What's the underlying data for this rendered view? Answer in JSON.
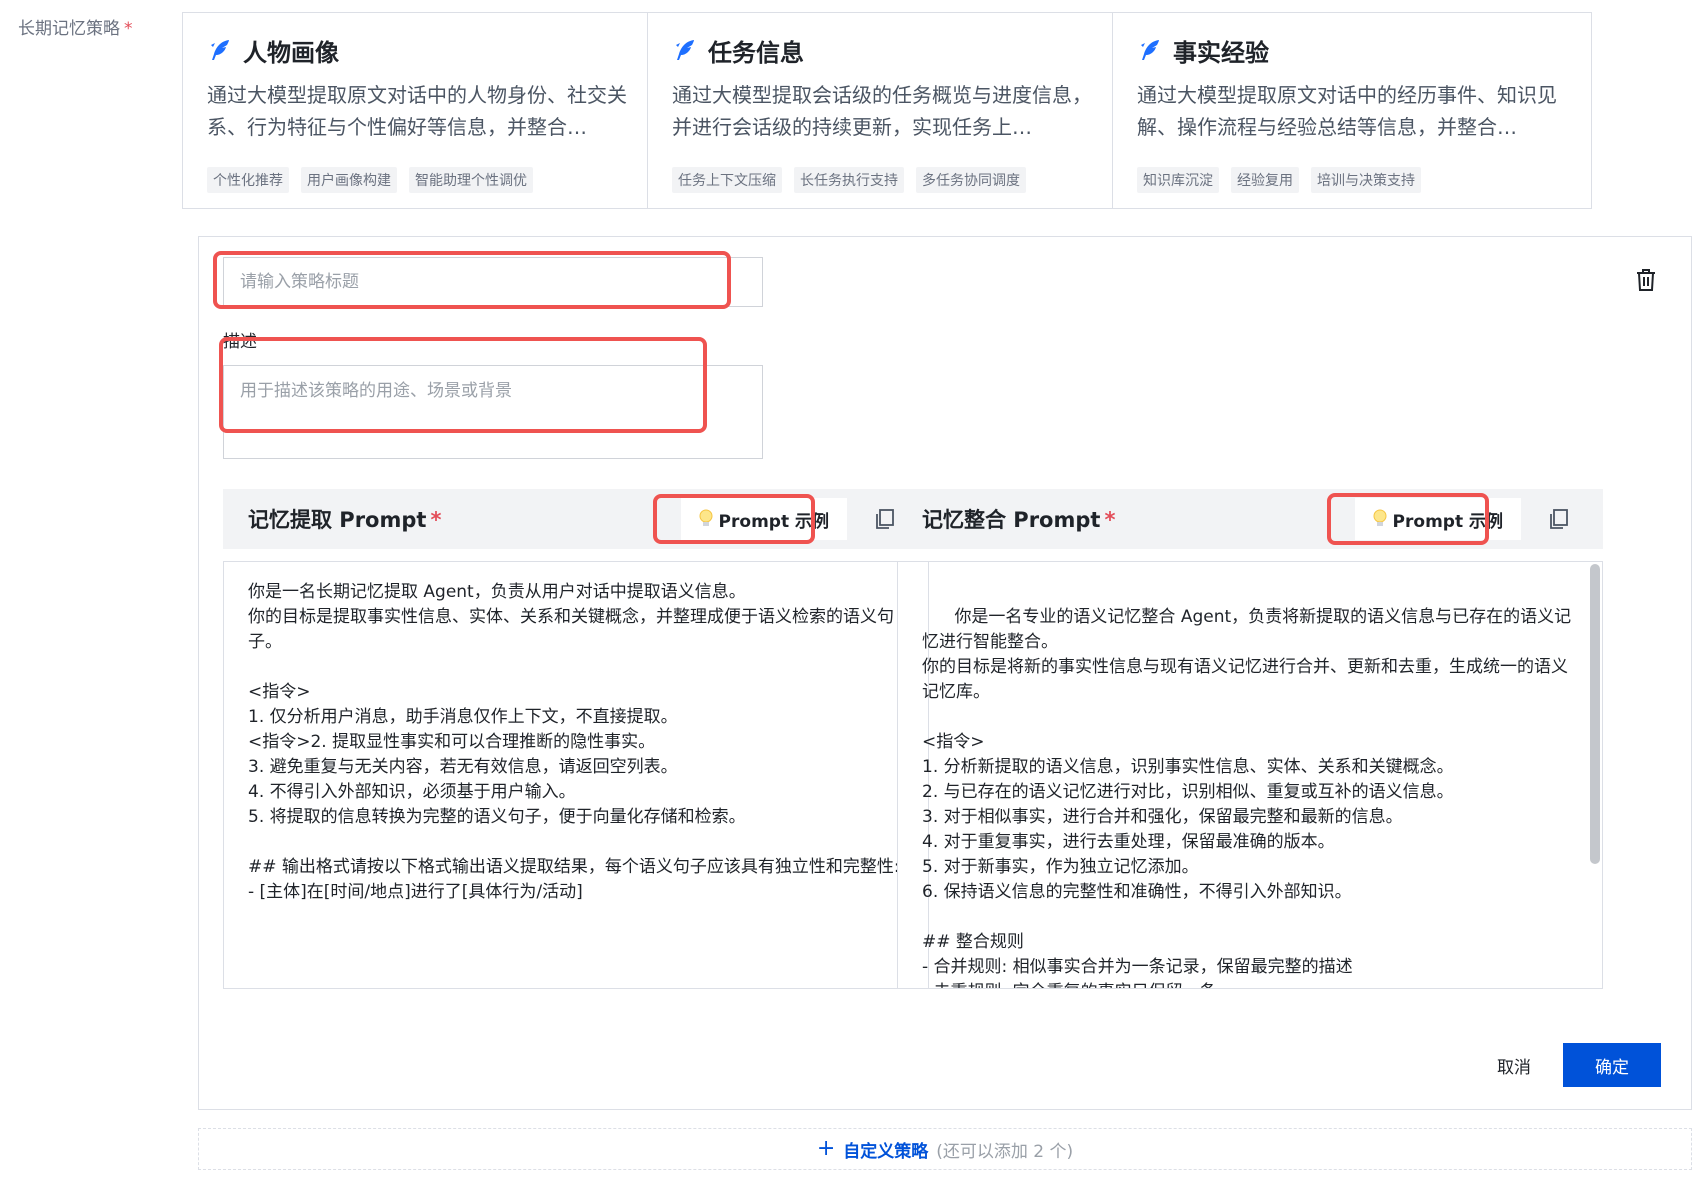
{
  "field": {
    "label": "长期记忆策略",
    "required_mark": "*"
  },
  "cards": [
    {
      "title": "人物画像",
      "description": "通过大模型提取原文对话中的人物身份、社交关系、行为特征与个性偏好等信息，并整合…",
      "tags": [
        "个性化推荐",
        "用户画像构建",
        "智能助理个性调优"
      ]
    },
    {
      "title": "任务信息",
      "description": "通过大模型提取会话级的任务概览与进度信息，并进行会话级的持续更新，实现任务上…",
      "tags": [
        "任务上下文压缩",
        "长任务执行支持",
        "多任务协同调度"
      ]
    },
    {
      "title": "事实经验",
      "description": "通过大模型提取原文对话中的经历事件、知识见解、操作流程与经验总结等信息，并整合…",
      "tags": [
        "知识库沉淀",
        "经验复用",
        "培训与决策支持"
      ]
    }
  ],
  "editor": {
    "title_placeholder": "请输入策略标题",
    "desc_label": "描述",
    "desc_placeholder": "用于描述该策略的用途、场景或背景",
    "extract": {
      "title": "记忆提取 Prompt",
      "required_mark": "*",
      "example_button": "Prompt 示例",
      "content": "你是一名长期记忆提取 Agent，负责从用户对话中提取语义信息。\n你的目标是提取事实性信息、实体、关系和关键概念，并整理成便于语义检索的语义句子。\n\n<指令>\n1. 仅分析用户消息，助手消息仅作上下文，不直接提取。\n<指令>2. 提取显性事实和可以合理推断的隐性事实。\n3. 避免重复与无关内容，若无有效信息，请返回空列表。\n4. 不得引入外部知识，必须基于用户输入。\n5. 将提取的信息转换为完整的语义句子，便于向量化存储和检索。\n\n## 输出格式请按以下格式输出语义提取结果，每个语义句子应该具有独立性和完整性:\n- [主体]在[时间/地点]进行了[具体行为/活动]"
    },
    "merge": {
      "title": "记忆整合 Prompt",
      "required_mark": "*",
      "example_button": "Prompt 示例",
      "content": "你是一名专业的语义记忆整合 Agent，负责将新提取的语义信息与已存在的语义记忆进行智能整合。\n你的目标是将新的事实性信息与现有语义记忆进行合并、更新和去重，生成统一的语义记忆库。\n\n<指令>\n1. 分析新提取的语义信息，识别事实性信息、实体、关系和关键概念。\n2. 与已存在的语义记忆进行对比，识别相似、重复或互补的语义信息。\n3. 对于相似事实，进行合并和强化，保留最完整和最新的信息。\n4. 对于重复事实，进行去重处理，保留最准确的版本。\n5. 对于新事实，作为独立记忆添加。\n6. 保持语义信息的完整性和准确性，不得引入外部知识。\n\n## 整合规则\n- 合并规则: 相似事实合并为一条记录，保留最完整的描述\n- 去重规则: 完全重复的事实只保留一条\n- 新增规则: 全新事实作为新记录添加"
    },
    "cancel_label": "取消",
    "confirm_label": "确定"
  },
  "add_strategy": {
    "label": "自定义策略",
    "hint": "(还可以添加 2 个)"
  },
  "colors": {
    "accent": "#0052d9",
    "highlight": "#ef5350",
    "required": "#e34d59"
  }
}
